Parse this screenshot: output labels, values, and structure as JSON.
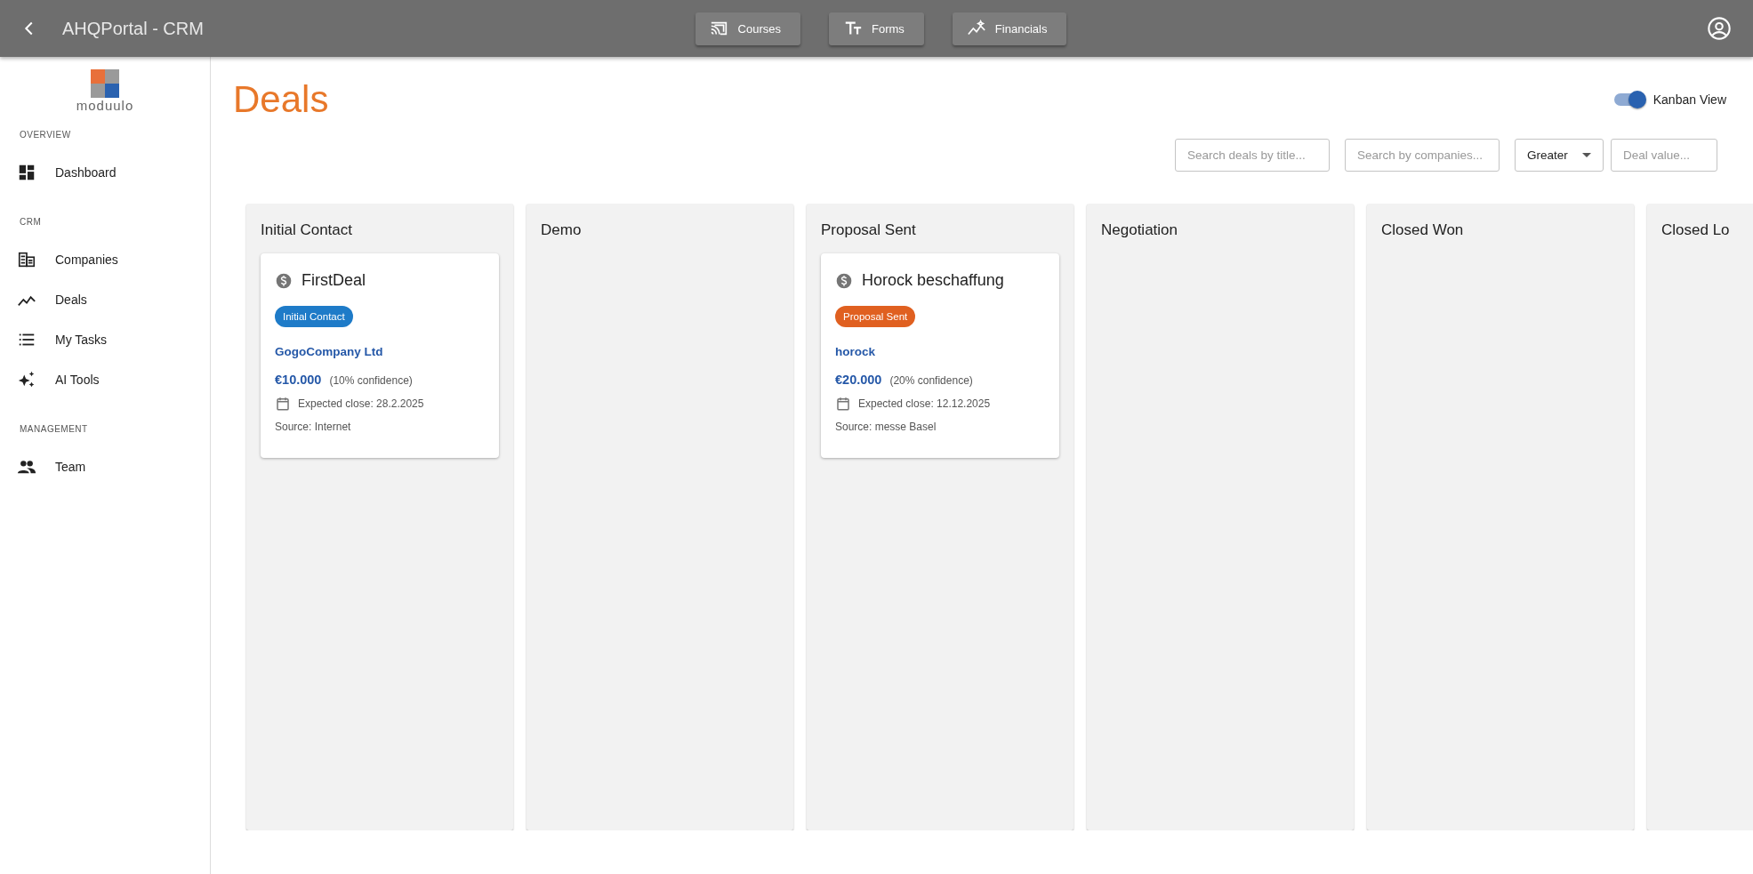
{
  "app_bar": {
    "title": "AHQPortal - CRM",
    "nav_buttons": [
      {
        "label": "Courses"
      },
      {
        "label": "Forms"
      },
      {
        "label": "Financials"
      }
    ]
  },
  "sidebar": {
    "logo_text": "moduulo",
    "sections": [
      {
        "heading": "OVERVIEW",
        "items": [
          {
            "label": "Dashboard"
          }
        ]
      },
      {
        "heading": "CRM",
        "items": [
          {
            "label": "Companies"
          },
          {
            "label": "Deals"
          },
          {
            "label": "My Tasks"
          },
          {
            "label": "AI Tools"
          }
        ]
      },
      {
        "heading": "MANAGEMENT",
        "items": [
          {
            "label": "Team"
          }
        ]
      }
    ]
  },
  "page": {
    "title": "Deals",
    "view_toggle": {
      "label": "Kanban View",
      "on": true
    },
    "filters": {
      "title_search": {
        "placeholder": "Search deals by title..."
      },
      "company_search": {
        "placeholder": "Search by companies..."
      },
      "comparison": {
        "value": "Greater"
      },
      "deal_value": {
        "placeholder": "Deal value..."
      }
    }
  },
  "board": {
    "columns": [
      {
        "title": "Initial Contact",
        "deals": [
          {
            "title": "FirstDeal",
            "stage": "Initial Contact",
            "color": "#1e7bc8",
            "company": "GogoCompany Ltd",
            "amount": "€10.000",
            "confidence": "(10% confidence)",
            "expected_close": "Expected close: 28.2.2025",
            "source": "Source: Internet"
          }
        ]
      },
      {
        "title": "Demo"
      },
      {
        "title": "Proposal Sent",
        "deals": [
          {
            "title": "Horock beschaffung",
            "stage": "Proposal Sent",
            "color": "#e06020",
            "company": "horock",
            "amount": "€20.000",
            "confidence": "(20% confidence)",
            "expected_close": "Expected close: 12.12.2025",
            "source": "Source: messe Basel"
          }
        ]
      },
      {
        "title": "Negotiation"
      },
      {
        "title": "Closed Won"
      },
      {
        "title": "Closed Lo"
      }
    ]
  }
}
